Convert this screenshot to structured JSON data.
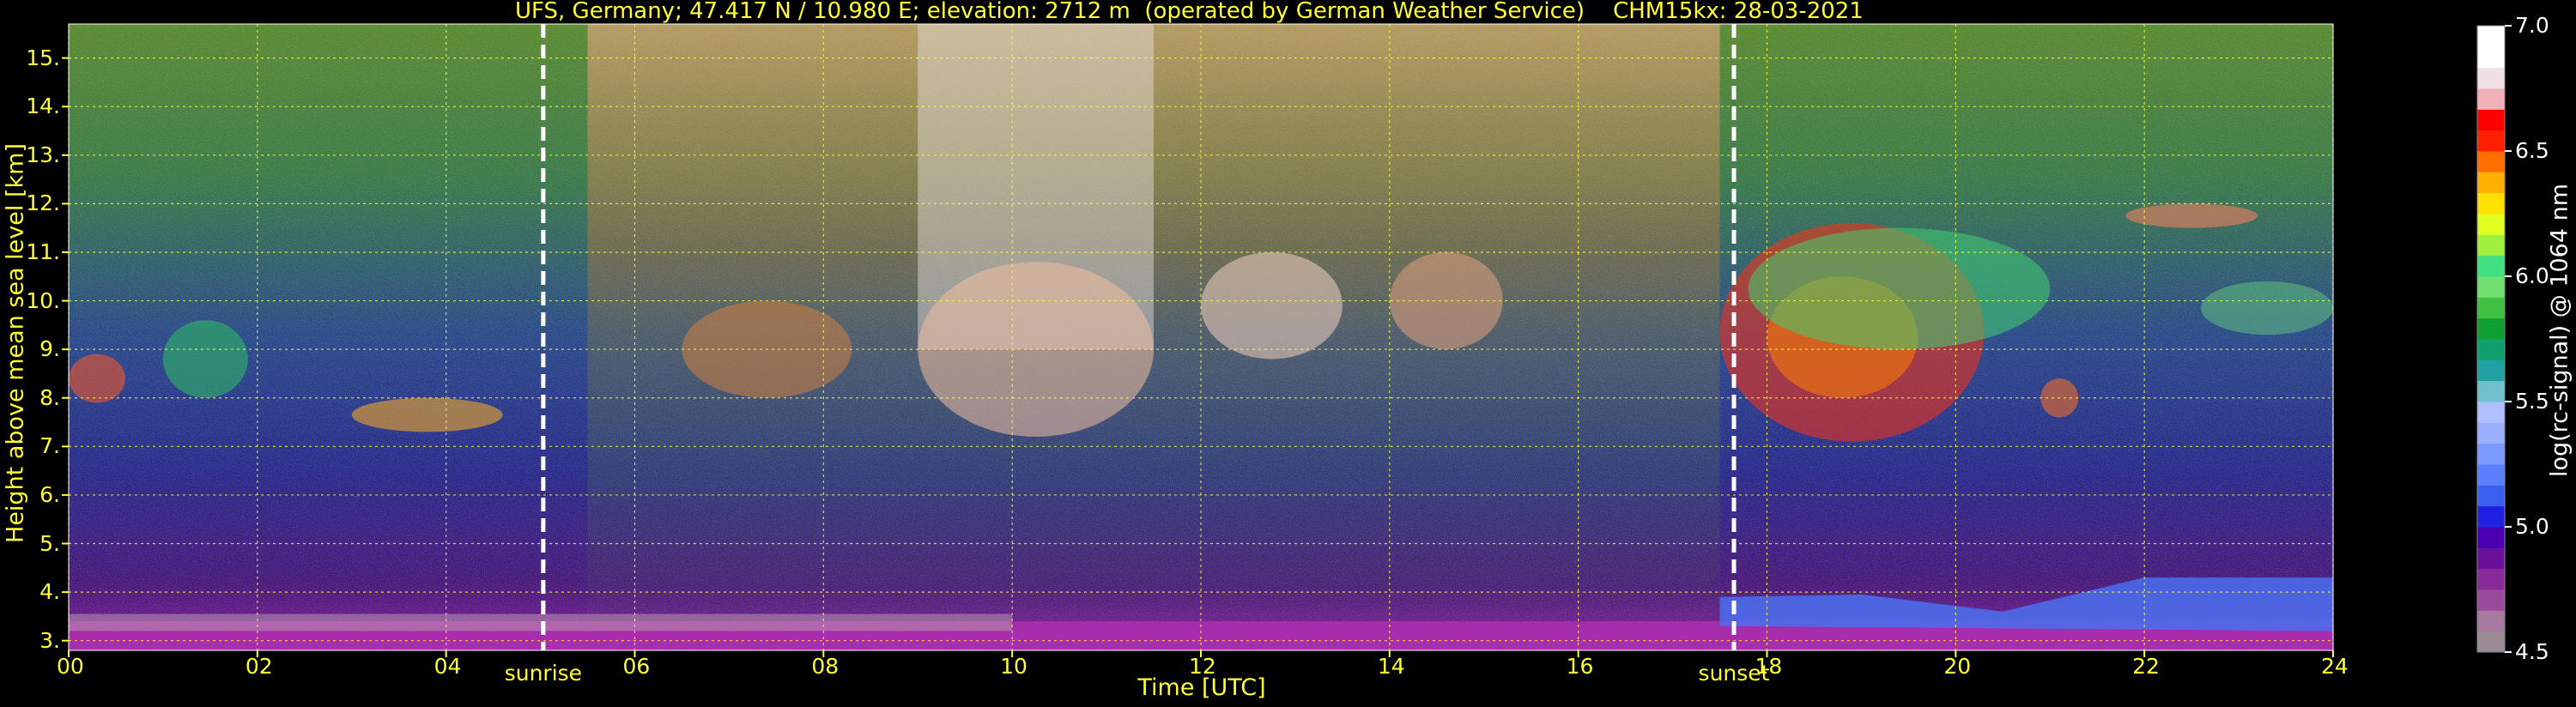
{
  "title": "UFS, Germany; 47.417 N / 10.980 E; elevation: 2712 m  (operated by German Weather Service)    CHM15kx: 28-03-2021",
  "xlabel": "Time [UTC]",
  "ylabel": "Height above mean sea level [km]",
  "colorbar_label": "log(rc-signal) @ 1064 nm",
  "colors": {
    "text": "#ffff33",
    "grid": "#ffff33",
    "marker": "#ffffff",
    "background": "#000000"
  },
  "chart_data": {
    "type": "heatmap",
    "title": "UFS, Germany; 47.417 N / 10.980 E; elevation: 2712 m  (operated by German Weather Service)    CHM15kx: 28-03-2021",
    "xlabel": "Time [UTC]",
    "ylabel": "Height above mean sea level [km]",
    "xlim": [
      0,
      24
    ],
    "ylim": [
      2.8,
      15.7
    ],
    "x_ticks": [
      0,
      2,
      4,
      6,
      8,
      10,
      12,
      14,
      16,
      18,
      20,
      22,
      24
    ],
    "x_tick_labels": [
      "00",
      "02",
      "04",
      "06",
      "08",
      "10",
      "12",
      "14",
      "16",
      "18",
      "20",
      "22",
      "24"
    ],
    "y_ticks": [
      3,
      4,
      5,
      6,
      7,
      8,
      9,
      10,
      11,
      12,
      13,
      14,
      15
    ],
    "y_tick_labels": [
      "3.",
      "4.",
      "5.",
      "6.",
      "7.",
      "8.",
      "9.",
      "10.",
      "11.",
      "12.",
      "13.",
      "14.",
      "15."
    ],
    "grid": true,
    "markers": [
      {
        "label": "sunrise",
        "x": 5.03
      },
      {
        "label": "sunset",
        "x": 17.65
      }
    ],
    "colorbar": {
      "label": "log(rc-signal) @ 1064 nm",
      "min": 4.5,
      "max": 7.0,
      "ticks": [
        4.5,
        5.0,
        5.5,
        6.0,
        6.5,
        7.0
      ],
      "tick_labels": [
        "4.5",
        "5.0",
        "5.5",
        "6.0",
        "6.5",
        "7.0"
      ],
      "colors": [
        "#9a8a94",
        "#a87aa0",
        "#9a4a9a",
        "#8a2a9a",
        "#6a109a",
        "#4a00b0",
        "#2020e0",
        "#3a60f0",
        "#5a80ff",
        "#7a9aff",
        "#9ab0ff",
        "#b0c0ff",
        "#70c0d0",
        "#20a0a0",
        "#10a070",
        "#10a030",
        "#40c040",
        "#70e070",
        "#40e080",
        "#a0f040",
        "#e0ff20",
        "#ffe000",
        "#ffb000",
        "#ff7000",
        "#ff2000",
        "#ff0000",
        "#f0b0b8",
        "#f0e0e4",
        "#ffffff",
        "#ffffff"
      ]
    }
  }
}
